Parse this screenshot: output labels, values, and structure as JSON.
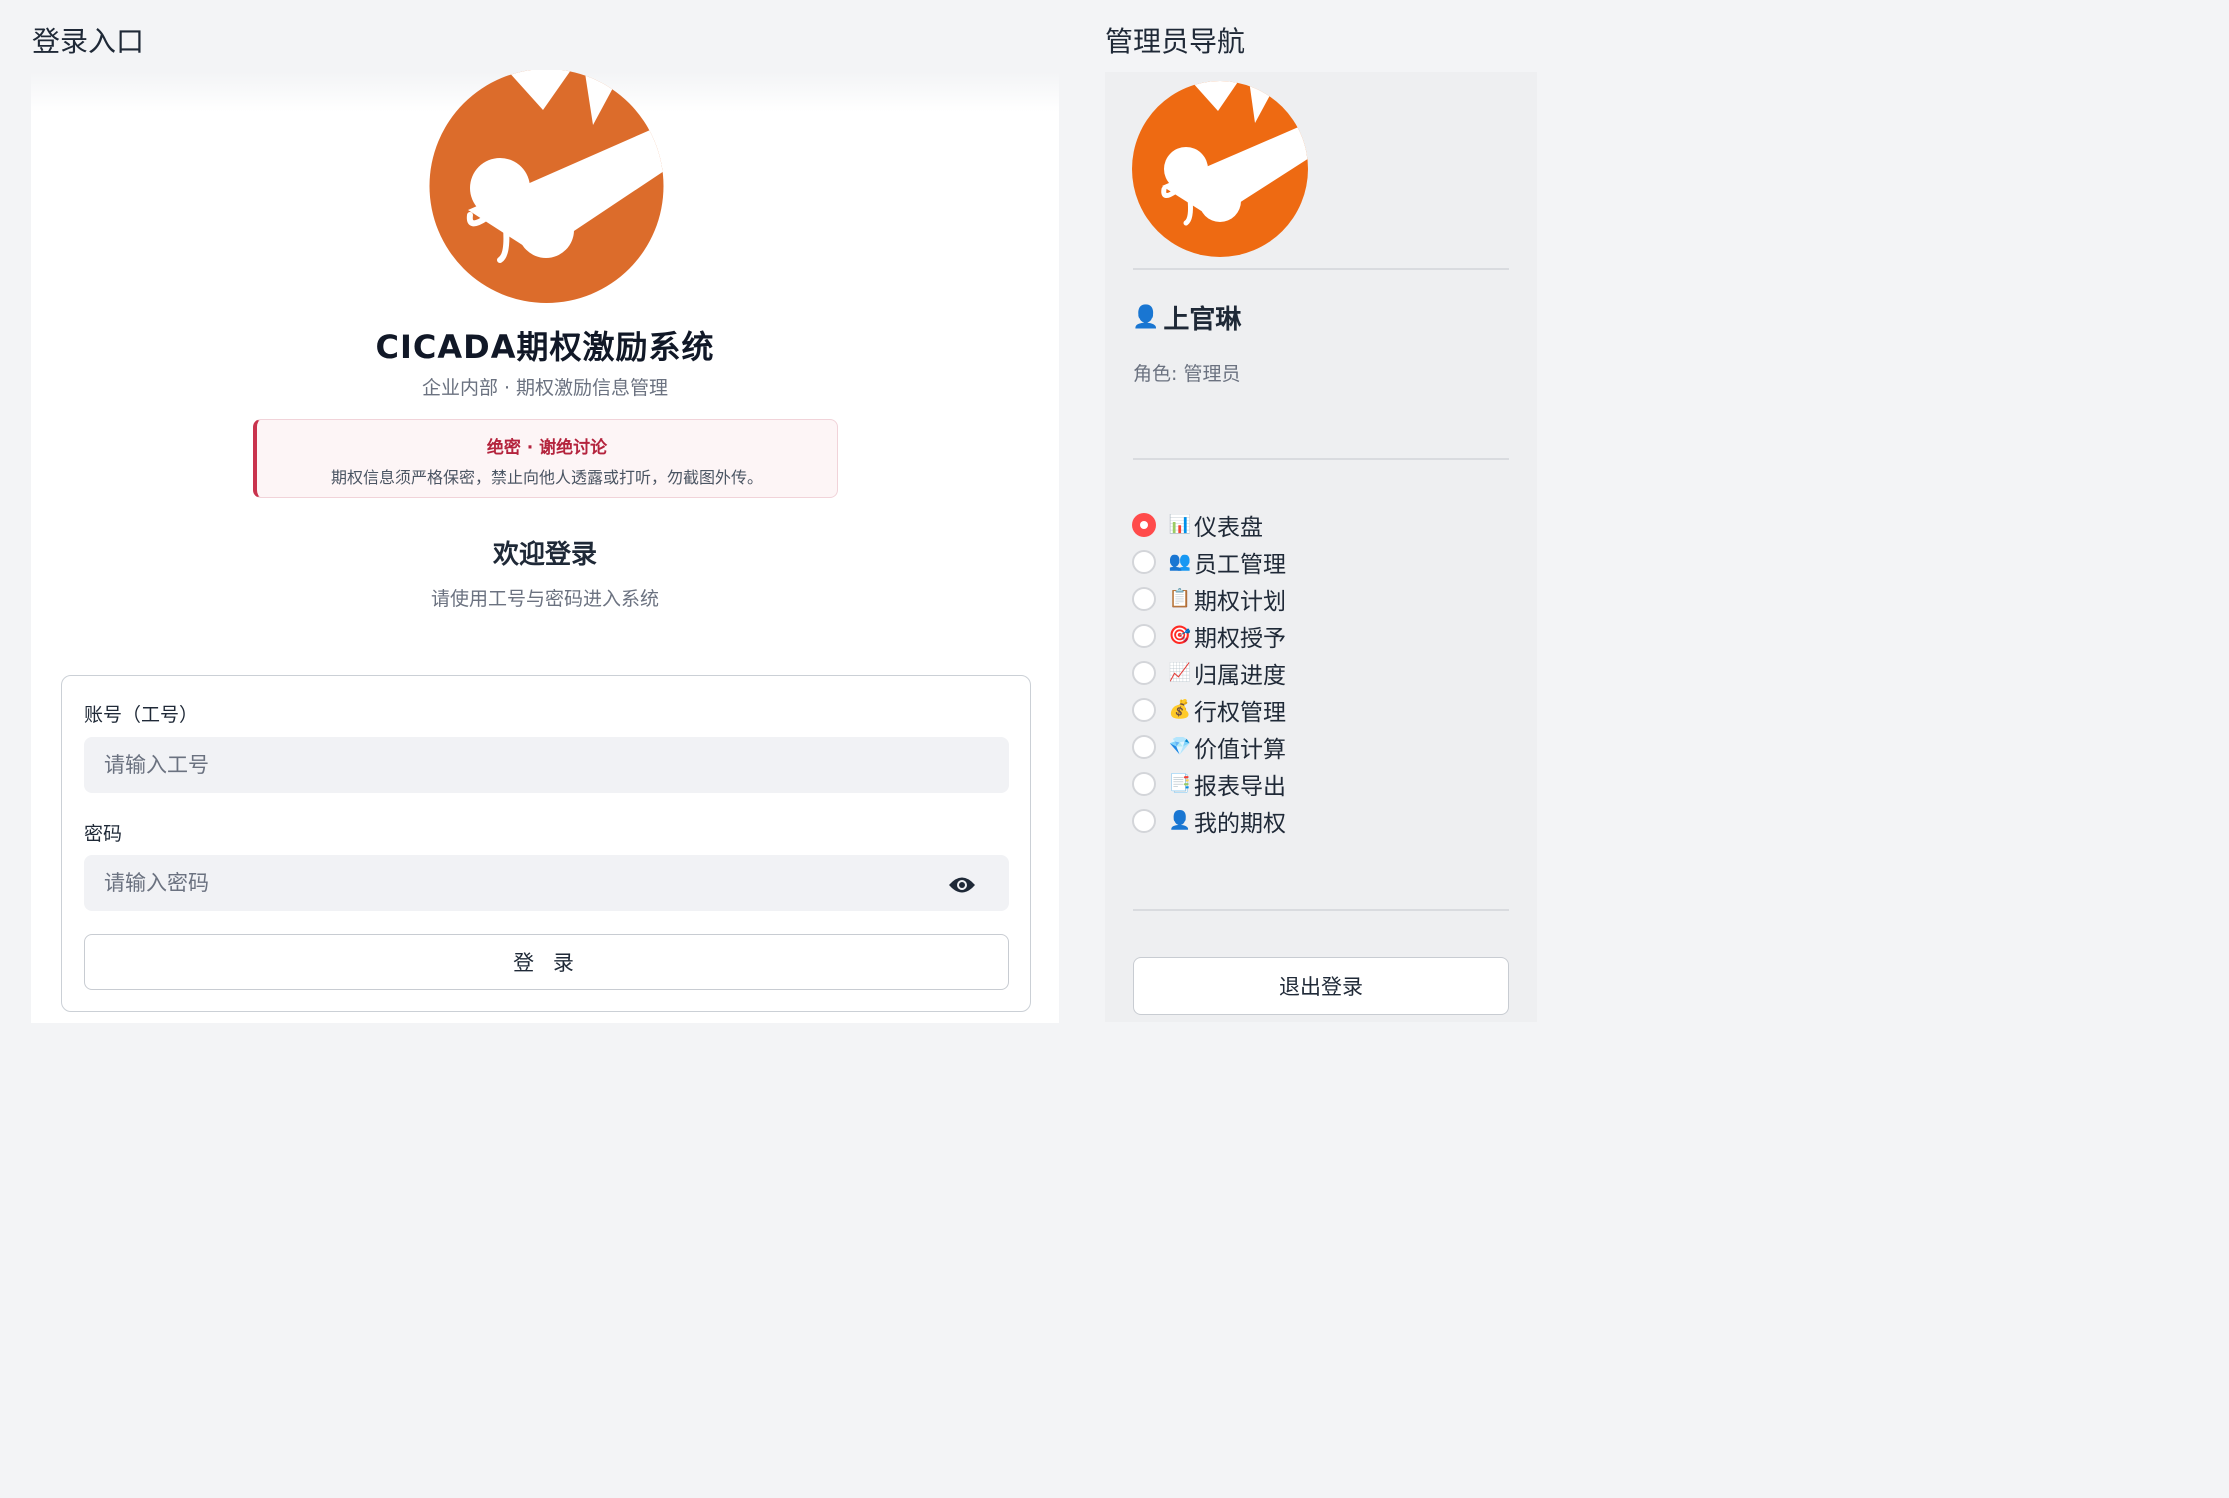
{
  "login_section": {
    "title": "登录入口",
    "app_title": "CICADA期权激励系统",
    "app_subtitle": "企业内部 · 期权激励信息管理",
    "notice": {
      "title": "绝密 · 谢绝讨论",
      "text": "期权信息须严格保密，禁止向他人透露或打听，勿截图外传。"
    },
    "welcome_title": "欢迎登录",
    "welcome_subtitle": "请使用工号与密码进入系统",
    "form": {
      "account_label": "账号（工号）",
      "account_placeholder": "请输入工号",
      "password_label": "密码",
      "password_placeholder": "请输入密码",
      "submit_label": "登 录"
    }
  },
  "nav_section": {
    "title": "管理员导航",
    "user": {
      "icon": "👤",
      "name": "上官琳",
      "role": "角色: 管理员"
    },
    "items": [
      {
        "emoji": "📊",
        "label": "仪表盘",
        "selected": true
      },
      {
        "emoji": "👥",
        "label": "员工管理",
        "selected": false
      },
      {
        "emoji": "📋",
        "label": "期权计划",
        "selected": false
      },
      {
        "emoji": "🎯",
        "label": "期权授予",
        "selected": false
      },
      {
        "emoji": "📈",
        "label": "归属进度",
        "selected": false
      },
      {
        "emoji": "💰",
        "label": "行权管理",
        "selected": false
      },
      {
        "emoji": "💎",
        "label": "价值计算",
        "selected": false
      },
      {
        "emoji": "📑",
        "label": "报表导出",
        "selected": false
      },
      {
        "emoji": "👤",
        "label": "我的期权",
        "selected": false
      }
    ],
    "logout_label": "退出登录"
  },
  "colors": {
    "logo_orange_login": "#dc6c2b",
    "logo_orange_nav": "#ee6a12",
    "notice_accent": "#c9334d",
    "radio_selected": "#ff4b4b"
  }
}
